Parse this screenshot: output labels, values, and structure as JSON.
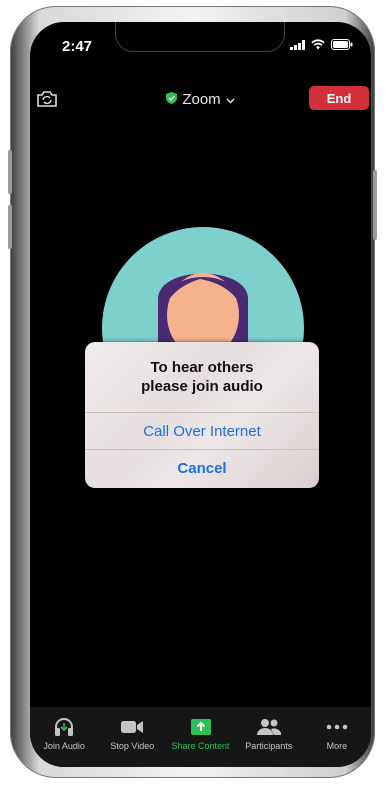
{
  "status_bar": {
    "time": "2:47"
  },
  "top_bar": {
    "meeting_title": "Zoom",
    "end_label": "End"
  },
  "dialog": {
    "title_line1": "To hear others",
    "title_line2": "please join audio",
    "call_over_internet": "Call Over Internet",
    "cancel": "Cancel"
  },
  "toolbar": {
    "items": [
      {
        "label": "Join Audio",
        "icon": "headphones-icon"
      },
      {
        "label": "Stop Video",
        "icon": "video-camera-icon"
      },
      {
        "label": "Share Content",
        "icon": "share-screen-icon"
      },
      {
        "label": "Participants",
        "icon": "participants-icon"
      },
      {
        "label": "More",
        "icon": "more-icon"
      }
    ]
  },
  "colors": {
    "end_red": "#d2303a",
    "link_blue": "#1e6fe0",
    "share_green": "#2fbf57",
    "avatar_teal": "#7dd0cc",
    "hair_purple": "#4a2a73",
    "skin": "#f6b28d"
  }
}
